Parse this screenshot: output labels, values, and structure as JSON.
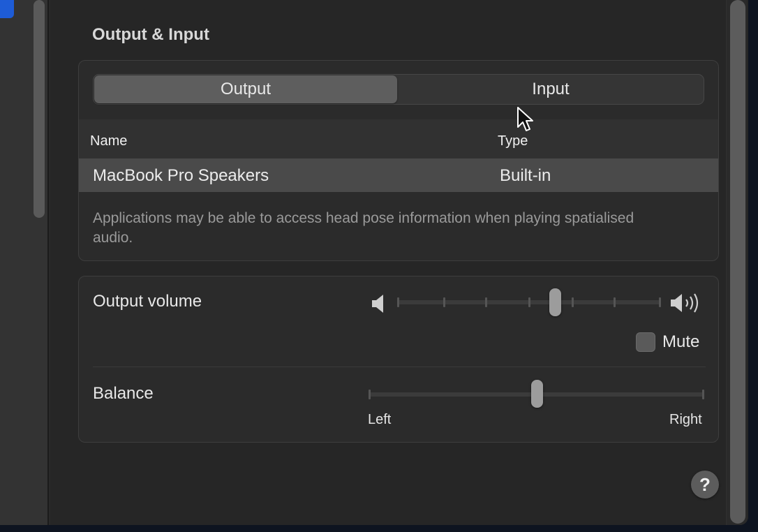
{
  "section": {
    "title": "Output & Input"
  },
  "segmented": {
    "output_label": "Output",
    "input_label": "Input",
    "selected": "Output"
  },
  "table": {
    "headers": {
      "name": "Name",
      "type": "Type"
    },
    "rows": [
      {
        "name": "MacBook Pro Speakers",
        "type": "Built-in"
      }
    ]
  },
  "note": {
    "text": "Applications may be able to access head pose information when playing spatialised audio."
  },
  "volume": {
    "label": "Output volume",
    "level": 0.6,
    "mute_label": "Mute",
    "muted": false
  },
  "balance": {
    "label": "Balance",
    "left_label": "Left",
    "right_label": "Right",
    "value": 0.5
  },
  "help": {
    "label": "?"
  },
  "icons": [
    "speaker-low-icon",
    "speaker-high-icon",
    "question-icon",
    "mouse-cursor-icon"
  ],
  "colors": {
    "accent": "#1e5cd6",
    "background": "#262626",
    "panel": "#2b2b2b"
  }
}
